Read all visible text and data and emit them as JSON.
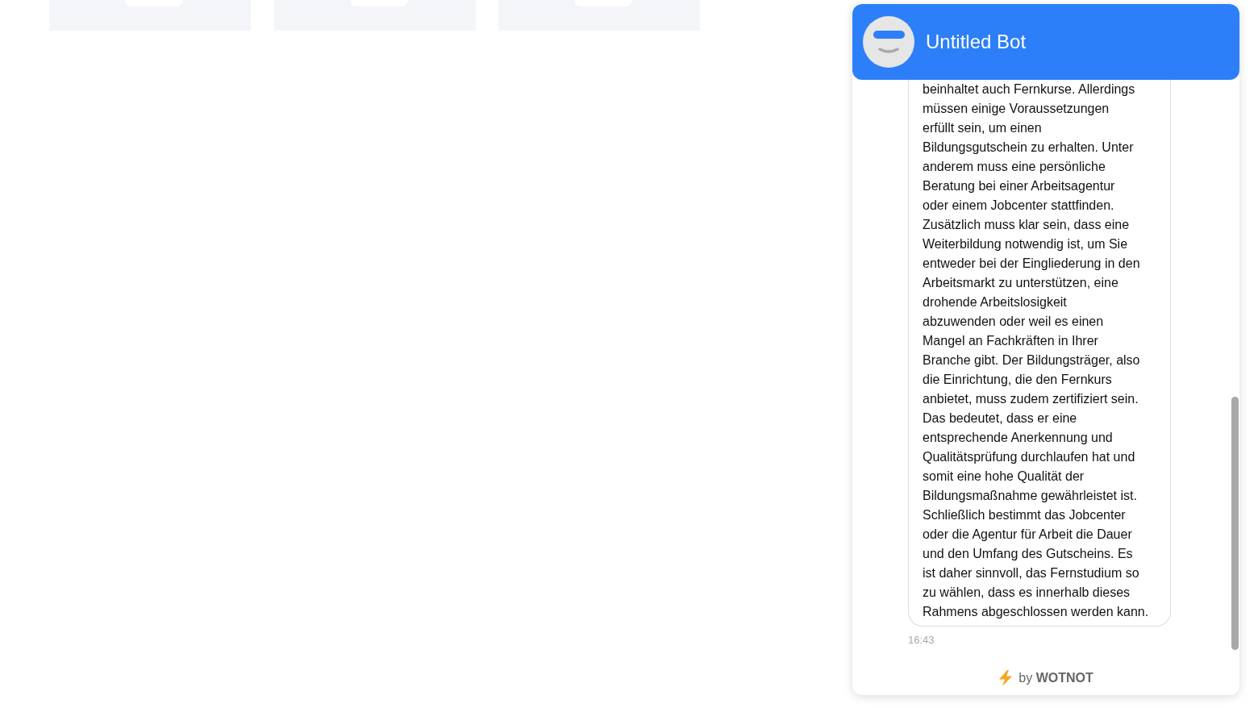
{
  "chat": {
    "title": "Untitled Bot",
    "message": {
      "text": "beinhaltet auch Fernkurse. Allerdings\nmüssen einige Voraussetzungen\nerfüllt sein, um einen\nBildungsgutschein zu erhalten. Unter\nanderem muss eine persönliche\nBeratung bei einer Arbeitsagentur\noder einem Jobcenter stattfinden.\nZusätzlich muss klar sein, dass eine\nWeiterbildung notwendig ist, um Sie\nentweder bei der Eingliederung in den\nArbeitsmarkt zu unterstützen, eine\ndrohende Arbeitslosigkeit\nabzuwenden oder weil es einen\nMangel an Fachkräften in Ihrer\nBranche gibt. Der Bildungsträger, also\ndie Einrichtung, die den Fernkurs\nanbietet, muss zudem zertifiziert sein.\nDas bedeutet, dass er eine\nentsprechende Anerkennung und\nQualitätsprüfung durchlaufen hat und\nsomit eine hohe Qualität der\nBildungsmaßnahme gewährleistet ist.\nSchließlich bestimmt das Jobcenter\noder die Agentur für Arbeit die Dauer\nund den Umfang des Gutscheins. Es\nist daher sinnvoll, das Fernstudium so\nzu wählen, dass es innerhalb dieses\nRahmens abgeschlossen werden kann.",
      "time": "16:43"
    },
    "footer": "by **WOTNOT**"
  }
}
